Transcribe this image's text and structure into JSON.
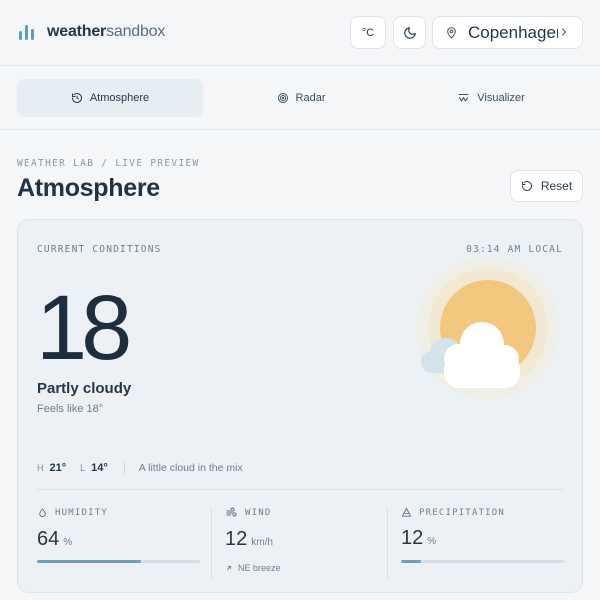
{
  "app": {
    "brand_bold": "weather",
    "brand_light": "sandbox"
  },
  "header": {
    "unit_label": "°C",
    "location": "Copenhagen"
  },
  "tabs": [
    {
      "label": "Atmosphere",
      "icon": "history-icon",
      "active": true
    },
    {
      "label": "Radar",
      "icon": "radar-icon",
      "active": false
    },
    {
      "label": "Visualizer",
      "icon": "wave-icon",
      "active": false
    }
  ],
  "breadcrumb": "WEATHER LAB / LIVE PREVIEW",
  "page_title": "Atmosphere",
  "reset_label": "Reset",
  "current": {
    "label": "CURRENT CONDITIONS",
    "local_time": "03:14 AM LOCAL",
    "temperature": "18",
    "degree_symbol": "°",
    "condition": "Partly cloudy",
    "feels_like": "Feels like 18°",
    "high_label": "H",
    "high": "21°",
    "low_label": "L",
    "low": "14°",
    "note": "A little cloud in the mix"
  },
  "stats": {
    "humidity": {
      "label": "HUMIDITY",
      "value": "64",
      "unit": "%",
      "level": 0.64
    },
    "wind": {
      "label": "WIND",
      "value": "12",
      "unit": "km/h",
      "sub": "NE breeze"
    },
    "precipitation": {
      "label": "PRECIPITATION",
      "value": "12",
      "unit": "%",
      "level": 0.12
    }
  },
  "colors": {
    "accent": "#5a9cc7",
    "sun": "#f4c77e",
    "bar_fill": "#6e9fbe"
  }
}
